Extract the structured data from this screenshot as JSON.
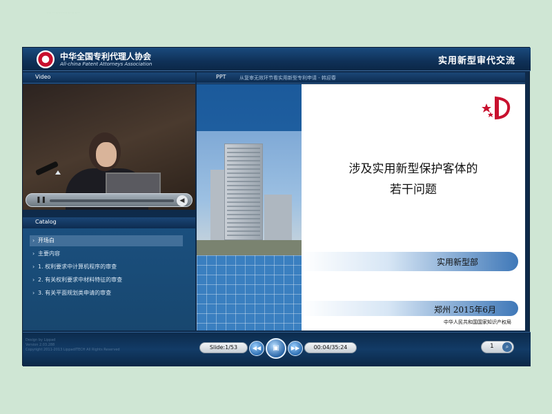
{
  "header": {
    "org_cn": "中华全国专利代理人协会",
    "org_en": "All-china Patent Attorneys Association",
    "right_title": "实用新型审代交流"
  },
  "video_panel": {
    "label": "Video"
  },
  "ppt_panel": {
    "label": "PPT",
    "subtitle": "从复审无效环节看实用新型专利申请 - 韩迎春"
  },
  "catalog": {
    "label": "Catalog",
    "items": [
      {
        "label": "开场白",
        "selected": true
      },
      {
        "label": "主要内容",
        "selected": false
      },
      {
        "label": "1. 权利要求中计算机程序的审查",
        "selected": false
      },
      {
        "label": "2. 有关权利要求中材料特征的审查",
        "selected": false
      },
      {
        "label": "3. 有关平面规划类申请的审查",
        "selected": false
      }
    ]
  },
  "slide": {
    "title_line1": "涉及实用新型保护客体的",
    "title_line2": "若干问题",
    "dept": "实用新型部",
    "location_date": "郑州  2015年6月",
    "agency": "中华人民共和国国家知识产权局"
  },
  "player": {
    "slide_counter": "Slide:1/53",
    "time": "00:04/35:24",
    "page_input": "1",
    "credits": [
      "Design by Lippad",
      "Version 2.03.288",
      "Copyright 2011-2013 LippadITECH All Rights Reserved"
    ]
  },
  "colors": {
    "page_bg": "#cfe6d4",
    "frame": "#0e2a4a",
    "accent": "#2d6fb3",
    "logo_red": "#c8102e"
  }
}
